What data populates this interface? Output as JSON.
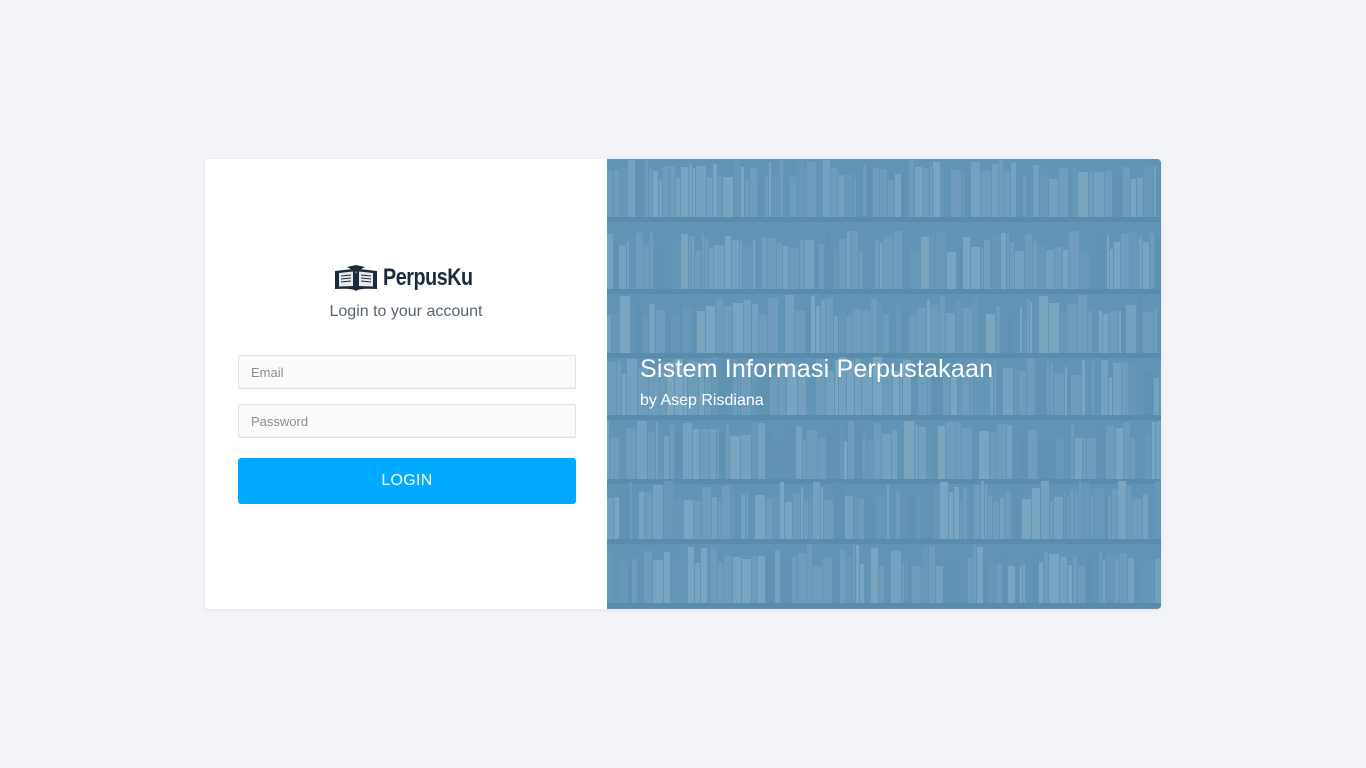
{
  "brand": {
    "name": "PerpusKu",
    "icon": "open-book-icon"
  },
  "login": {
    "subtitle": "Login to your account",
    "email_placeholder": "Email",
    "email_value": "",
    "password_placeholder": "Password",
    "password_value": "",
    "button_label": "LOGIN"
  },
  "hero": {
    "title": "Sistem Informasi Perpustakaan",
    "subtitle": "by Asep Risdiana",
    "background": "bookshelf-photo"
  },
  "colors": {
    "page_bg": "#f2f4f8",
    "accent": "#00aaff",
    "hero_tint": "#6095b3",
    "brand_text": "#1c2b3a"
  }
}
